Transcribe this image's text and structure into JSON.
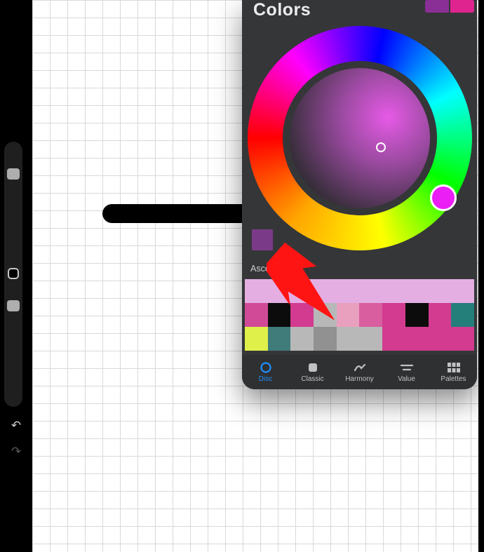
{
  "panel": {
    "title": "Colors",
    "prev_color": "#8a2f96",
    "current_color": "#e0248f",
    "history_swatch": "#7b3a87",
    "palette_label": "Ascend",
    "hue_pick_color": "#ea1ef5",
    "tabs": [
      {
        "id": "disc",
        "label": "Disc",
        "active": true
      },
      {
        "id": "classic",
        "label": "Classic",
        "active": false
      },
      {
        "id": "harmony",
        "label": "Harmony",
        "active": false
      },
      {
        "id": "value",
        "label": "Value",
        "active": false
      },
      {
        "id": "palettes",
        "label": "Palettes",
        "active": false
      }
    ],
    "palette": [
      [
        "#e4aee3",
        "#e4aee3",
        "#e4aee3",
        "#e4aee3",
        "#e4aee3",
        "#e4aee3",
        "#e4aee3",
        "#e4aee3",
        "#e4aee3",
        "#e4aee3"
      ],
      [
        "#d04a97",
        "#0c0c0c",
        "#d23b8f",
        "#b8b8b8",
        "#e9a0be",
        "#d85e9f",
        "#d23b8f",
        "#0c0c0c",
        "#d23b8f",
        "#247e7a"
      ],
      [
        "#dff04a",
        "#3f7c7a",
        "#b8b8b8",
        "#919191",
        "#b8b8b8",
        "#b8b8b8",
        "#d23b8f",
        "#d23b8f",
        "#d23b8f",
        "#d23b8f"
      ]
    ]
  },
  "sidebar": {
    "undo_icon": "undo-icon",
    "redo_icon": "redo-icon"
  },
  "annotation": {
    "type": "arrow",
    "color": "#ff1414"
  }
}
